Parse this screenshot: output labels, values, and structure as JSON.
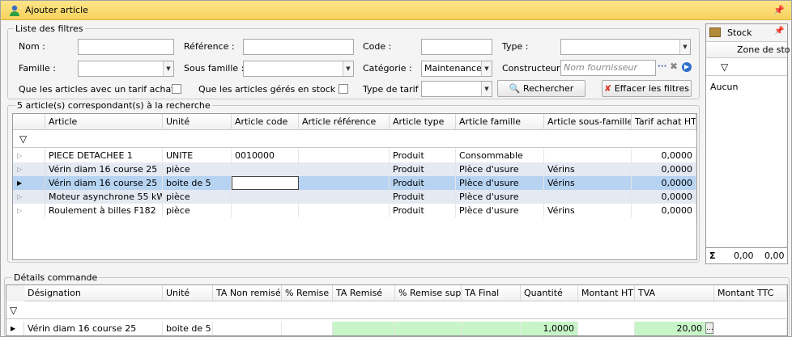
{
  "window": {
    "title": "Ajouter article"
  },
  "filters": {
    "title": "Liste des filtres",
    "nom_label": "Nom :",
    "nom_value": "",
    "reference_label": "Référence :",
    "reference_value": "",
    "code_label": "Code :",
    "code_value": "",
    "type_label": "Type :",
    "type_value": "",
    "famille_label": "Famille :",
    "famille_value": "",
    "sous_famille_label": "Sous famille :",
    "sous_famille_value": "",
    "categorie_label": "Catégorie :",
    "categorie_value": "Maintenance",
    "constructeur_label": "Constructeur :",
    "constructeur_placeholder": "Nom fournisseur",
    "tarif_achat_label": "Que les articles avec un tarif achat :",
    "geres_stock_label": "Que les articles gérés en stock :",
    "type_tarif_label": "Type de tarif :",
    "type_tarif_value": "",
    "search_button": "Rechercher",
    "clear_button": "Effacer les filtres"
  },
  "results": {
    "title": "5 article(s) correspondant(s) à la recherche",
    "columns": [
      "Article",
      "Unité",
      "Article code",
      "Article référence",
      "Article type",
      "Article famille",
      "Article sous-famille",
      "Tarif achat HT"
    ],
    "rows": [
      [
        "PIECE DETACHEE 1",
        "UNITE",
        "0010000",
        "",
        "Produit",
        "Consommable",
        "",
        "0,0000"
      ],
      [
        "Vérin diam 16 course 25",
        "pièce",
        "",
        "",
        "Produit",
        "Plèce d'usure",
        "Vérins",
        "0,0000"
      ],
      [
        "Vérin diam 16 course 25",
        "boite de 5",
        "",
        "",
        "Produit",
        "Plèce d'usure",
        "Vérins",
        "0,0000"
      ],
      [
        "Moteur asynchrone 55 kW",
        "pièce",
        "",
        "",
        "Produit",
        "Plèce d'usure",
        "",
        "0,0000"
      ],
      [
        "Roulement à billes F182",
        "pièce",
        "",
        "",
        "Produit",
        "Plèce d'usure",
        "Vérins",
        "0,0000"
      ]
    ]
  },
  "stock": {
    "title": "Stock",
    "column": "Zone de sto",
    "empty": "Aucun",
    "sum_symbol": "Σ",
    "total1": "0,00",
    "total2": "0,00"
  },
  "details": {
    "title": "Détails commande",
    "columns": [
      "Désignation",
      "Unité",
      "TA Non remisé",
      "% Remise",
      "TA Remisé",
      "% Remise sup.",
      "TA Final",
      "Quantité",
      "Montant HT",
      "TVA",
      "Montant TTC"
    ],
    "row": {
      "designation": "Vérin diam 16 course 25",
      "unite": "boite de 5",
      "quantite": "1,0000",
      "tva": "20,00"
    }
  },
  "colors": {
    "title_bar": "#f7d25c",
    "selected_row": "#b6d3f2",
    "alt_row": "#e4e9f2",
    "editable_cell": "#c8f5c8"
  }
}
